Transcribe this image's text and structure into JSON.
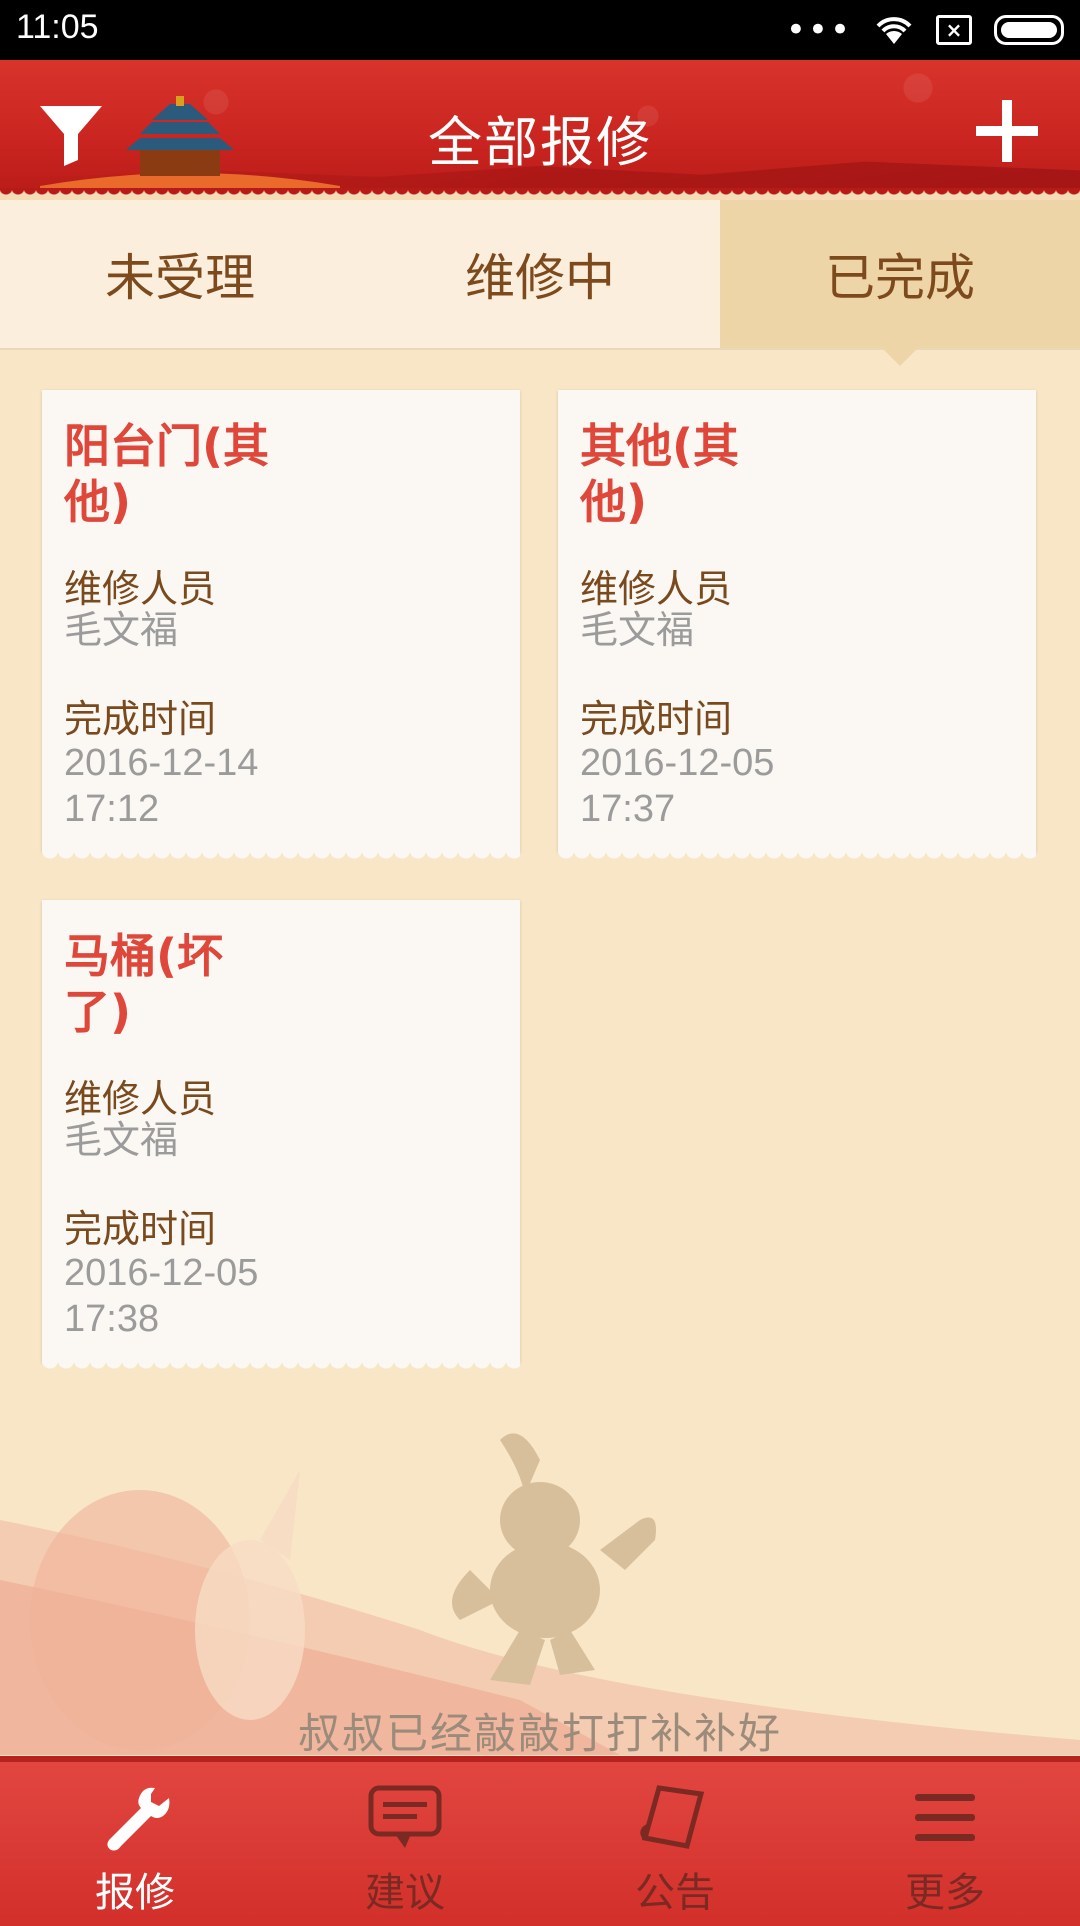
{
  "status_bar": {
    "time": "11:05",
    "icons": [
      "more-dots-icon",
      "wifi-icon",
      "no-sim-icon",
      "battery-icon"
    ],
    "sim_glyph": "×"
  },
  "header": {
    "title": "全部报修",
    "left_icon": "filter-icon",
    "right_icon": "add-icon",
    "color": "#c9241f"
  },
  "tabs": [
    {
      "label": "未受理",
      "active": false
    },
    {
      "label": "维修中",
      "active": false
    },
    {
      "label": "已完成",
      "active": true
    }
  ],
  "cards": [
    {
      "title_line1": "阳台门(其",
      "title_line2": "他)",
      "worker_label": "维修人员",
      "worker": "毛文福",
      "time_label": "完成时间",
      "date": "2016-12-14",
      "time": "17:12"
    },
    {
      "title_line1": "其他(其",
      "title_line2": "他)",
      "worker_label": "维修人员",
      "worker": "毛文福",
      "time_label": "完成时间",
      "date": "2016-12-05",
      "time": "17:37"
    },
    {
      "title_line1": "马桶(坏",
      "title_line2": "了)",
      "worker_label": "维修人员",
      "worker": "毛文福",
      "time_label": "完成时间",
      "date": "2016-12-05",
      "time": "17:38"
    }
  ],
  "footer_message": "叔叔已经敲敲打打补补好",
  "bottom_nav": [
    {
      "label": "报修",
      "icon": "wrench-icon",
      "active": true
    },
    {
      "label": "建议",
      "icon": "chat-bubble-icon",
      "active": false
    },
    {
      "label": "公告",
      "icon": "notice-icon",
      "active": false
    },
    {
      "label": "更多",
      "icon": "menu-icon",
      "active": false
    }
  ],
  "colors": {
    "accent_red": "#e0473b",
    "label_brown": "#7a4a1f",
    "value_gray": "#9b9b9b",
    "background": "#f8e6c6"
  }
}
